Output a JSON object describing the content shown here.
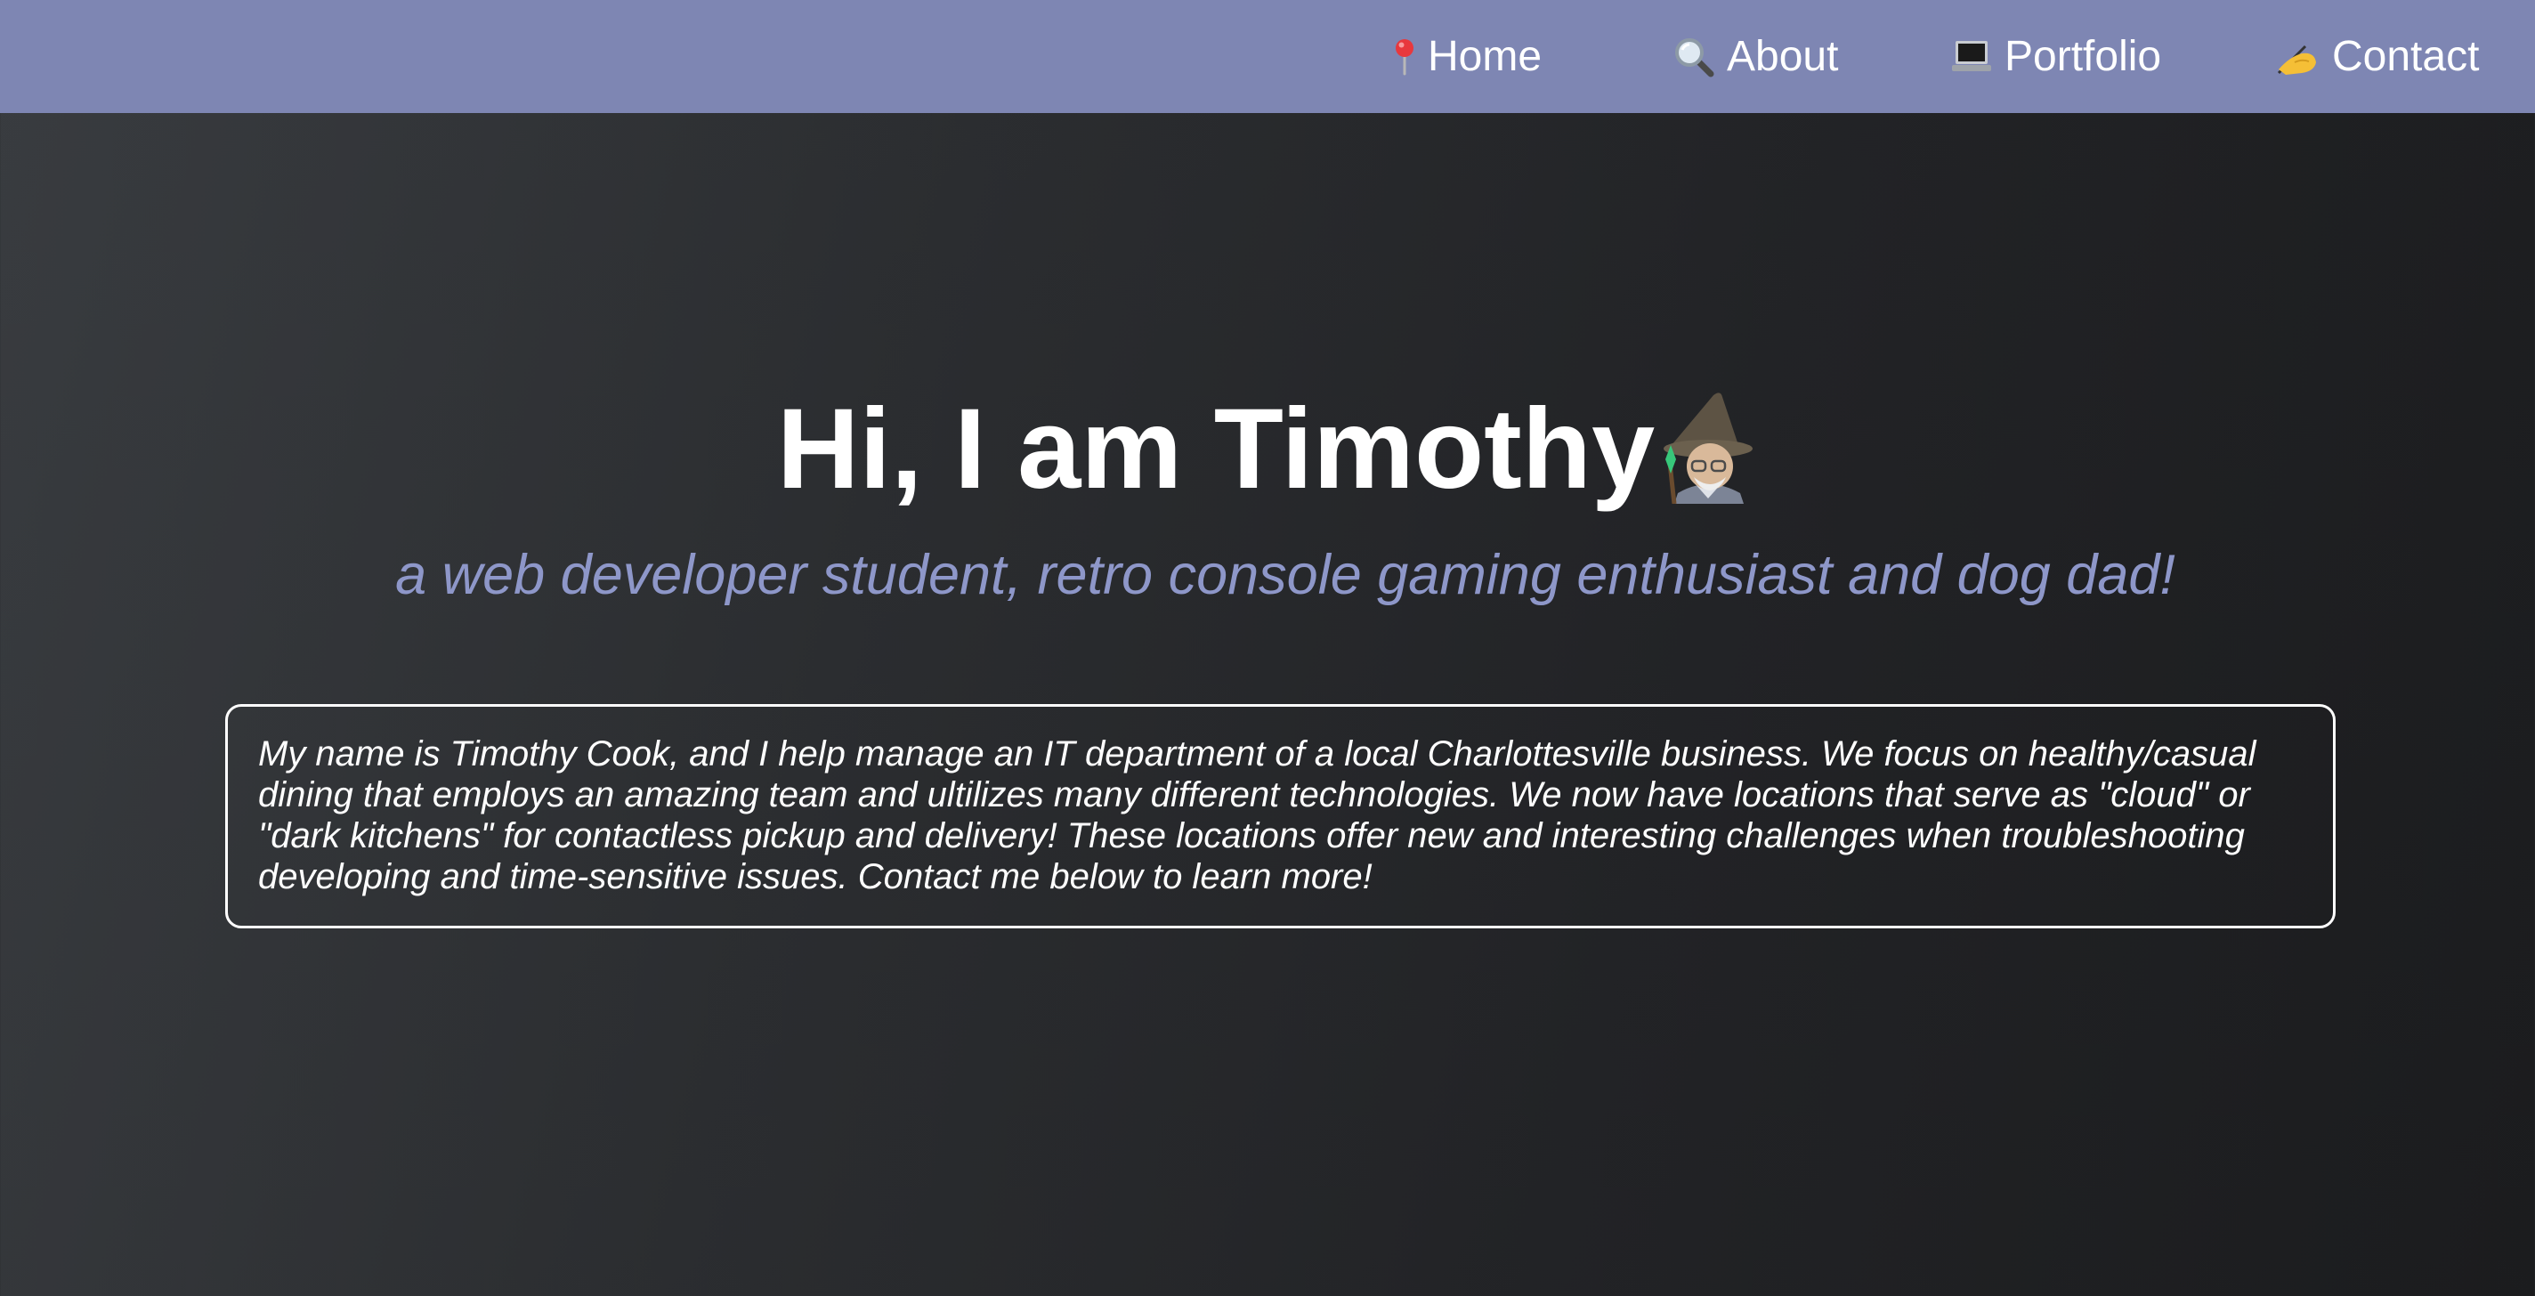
{
  "nav": {
    "items": [
      {
        "label": "Home",
        "icon": "pin-icon"
      },
      {
        "label": "About",
        "icon": "magnifier-icon"
      },
      {
        "label": "Portfolio",
        "icon": "laptop-icon"
      },
      {
        "label": "Contact",
        "icon": "writing-hand-icon"
      }
    ],
    "background": "#7e86b3"
  },
  "hero": {
    "title": "Hi, I am Timothy",
    "title_icon": "wizard-icon",
    "subtitle": "a web developer student, retro console gaming enthusiast and dog dad!",
    "subtitle_color": "#8e97c9"
  },
  "about": {
    "text": "My name is Timothy Cook, and I help manage an IT department of a local Charlottesville business. We focus on healthy/casual dining that employs an amazing team and ultilizes many different technologies. We now have locations that serve as \"cloud\" or \"dark kitchens\" for contactless pickup and delivery! These locations offer new and interesting challenges when troubleshooting developing and time-sensitive issues. Contact me below to learn more!"
  }
}
